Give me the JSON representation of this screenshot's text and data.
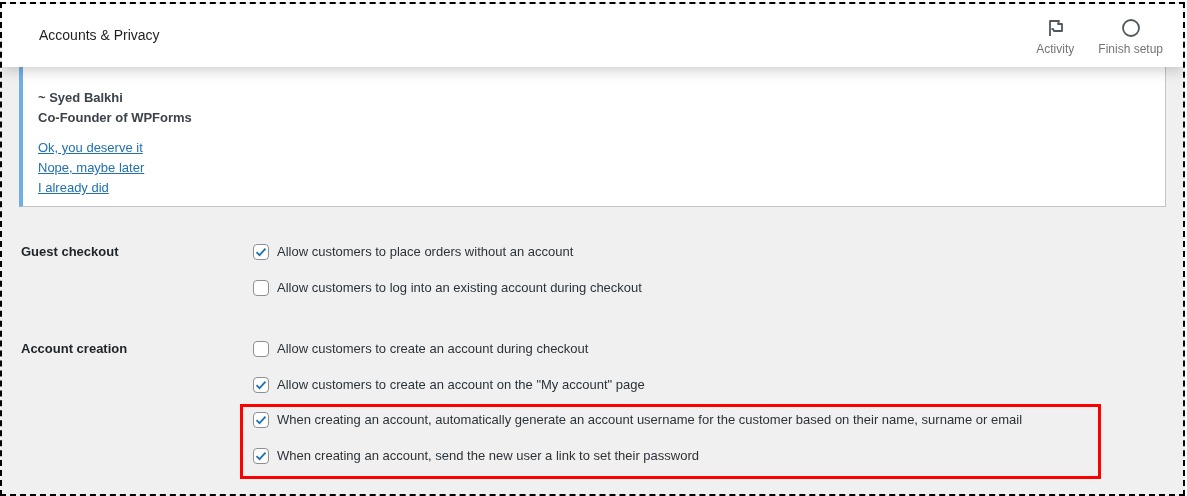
{
  "header": {
    "title": "Accounts & Privacy",
    "actions": [
      {
        "kind": "flag",
        "label": "Activity"
      },
      {
        "kind": "circle",
        "label": "Finish setup"
      }
    ]
  },
  "notice": {
    "author": "~ Syed Balkhi",
    "role": "Co-Founder of WPForms",
    "links": [
      "Ok, you deserve it",
      "Nope, maybe later",
      "I already did"
    ]
  },
  "sections": [
    {
      "label": "Guest checkout",
      "options": [
        {
          "label": "Allow customers to place orders without an account",
          "checked": true
        },
        {
          "label": "Allow customers to log into an existing account during checkout",
          "checked": false
        }
      ]
    },
    {
      "label": "Account creation",
      "options": [
        {
          "label": "Allow customers to create an account during checkout",
          "checked": false
        },
        {
          "label": "Allow customers to create an account on the \"My account\" page",
          "checked": true
        }
      ],
      "highlighted_options": [
        {
          "label": "When creating an account, automatically generate an account username for the customer based on their name, surname or email",
          "checked": true
        },
        {
          "label": "When creating an account, send the new user a link to set their password",
          "checked": true
        }
      ]
    }
  ]
}
